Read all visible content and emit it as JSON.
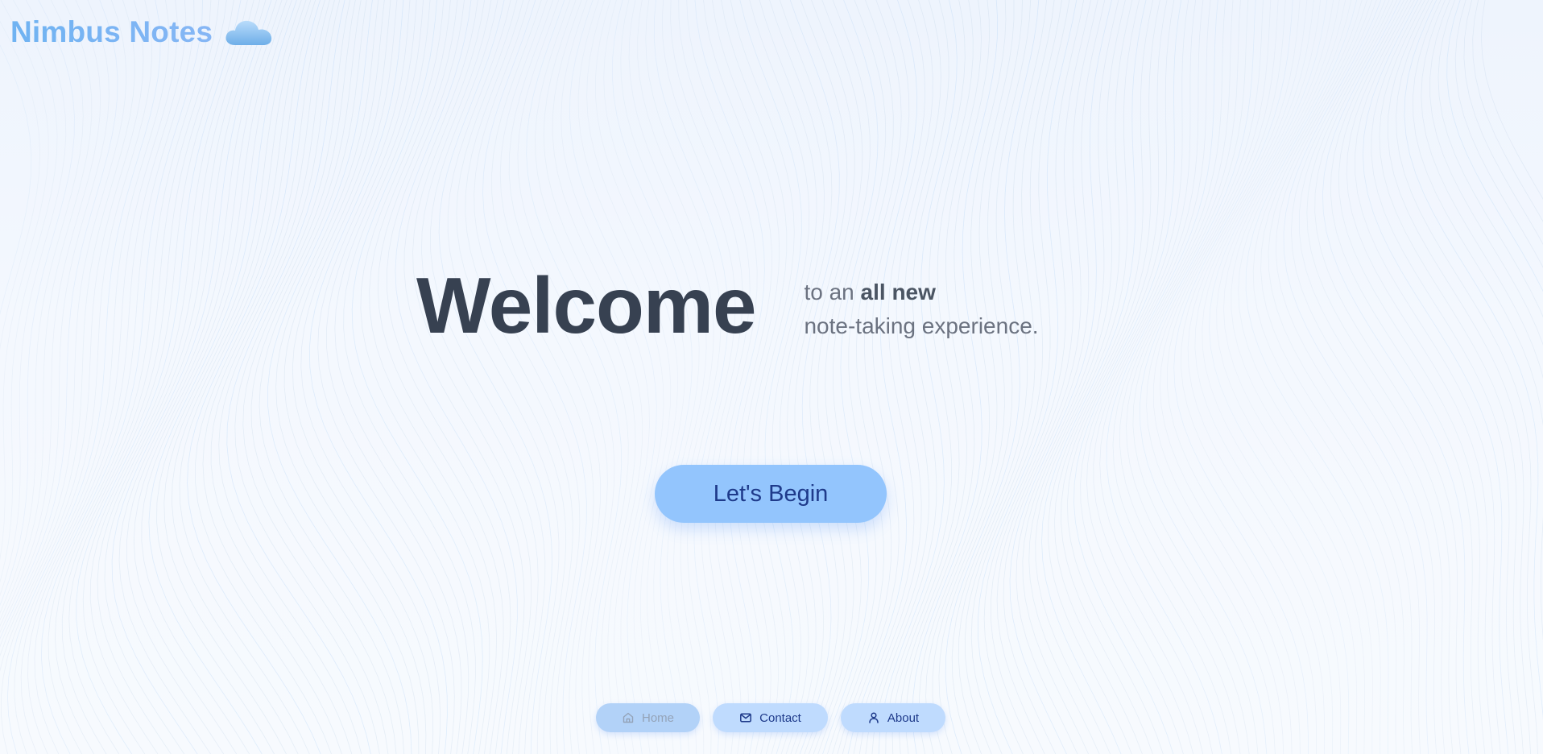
{
  "brand": {
    "name": "Nimbus Notes",
    "icon": "cloud-icon"
  },
  "hero": {
    "title": "Welcome",
    "subtitle_prefix": "to an ",
    "subtitle_emphasis": "all new",
    "subtitle_line2": "note-taking experience."
  },
  "cta": {
    "label": "Let's Begin"
  },
  "nav": {
    "items": [
      {
        "label": "Home",
        "icon": "home-icon",
        "state": "active"
      },
      {
        "label": "Contact",
        "icon": "mail-icon",
        "state": "default"
      },
      {
        "label": "About",
        "icon": "user-icon",
        "state": "default"
      }
    ]
  },
  "colors": {
    "background": "#f4f8fe",
    "accent": "#93c5fd",
    "nav_button": "#bfdbfe",
    "title": "#374151",
    "subtitle": "#6b7280",
    "brand_text": "#6fb3f2",
    "cta_text": "#1e3a8a"
  }
}
